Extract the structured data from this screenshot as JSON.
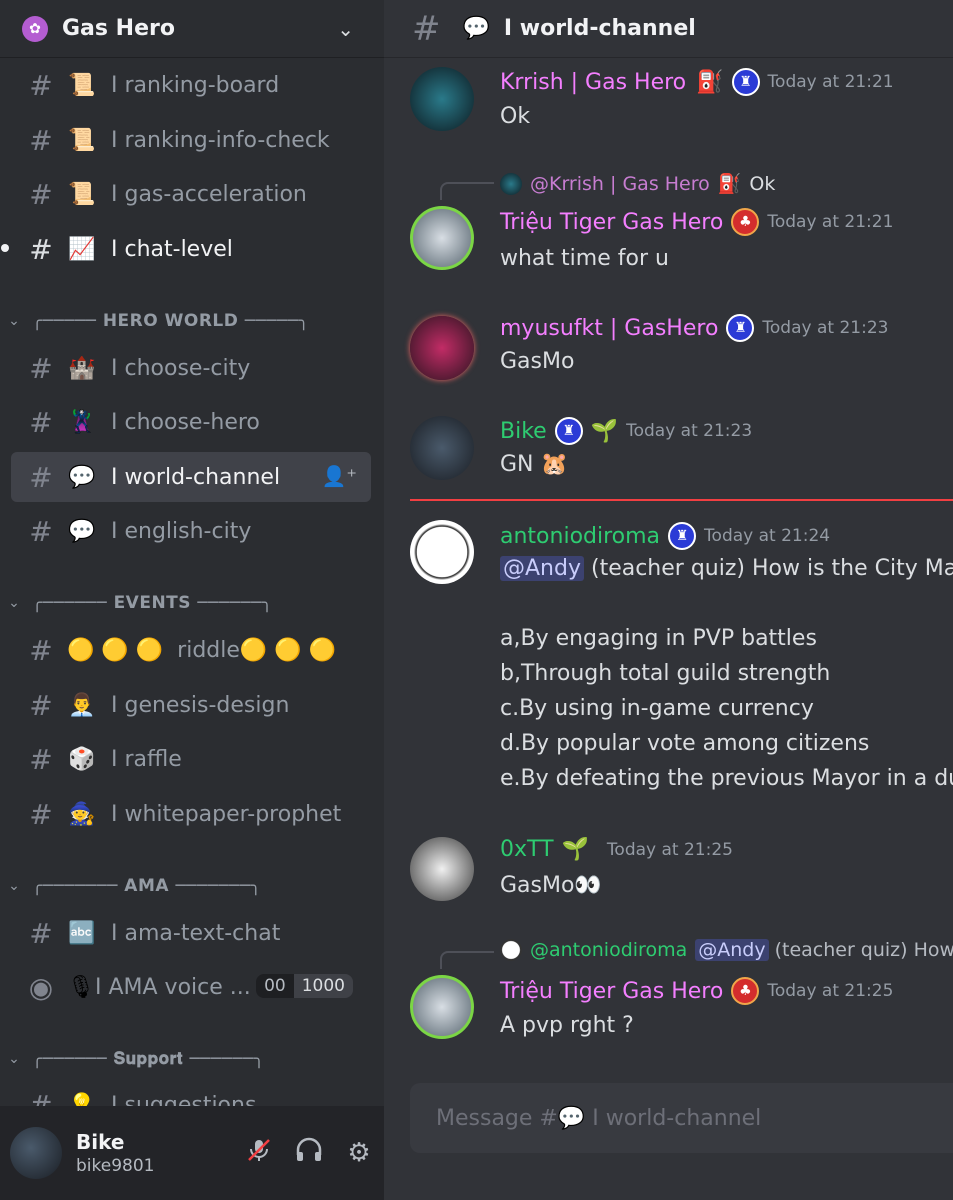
{
  "server": {
    "name": "Gas Hero",
    "icon": "gas-hero-server-icon"
  },
  "channels_top": [
    {
      "emoji": "📜",
      "name": "I ranking-board"
    },
    {
      "emoji": "📜",
      "name": "I ranking-info-check"
    },
    {
      "emoji": "📜",
      "name": "I gas-acceleration"
    },
    {
      "emoji": "📈",
      "name": "I chat-level"
    }
  ],
  "categories": {
    "hero_world": "╭───── HERO WORLD ─────╮",
    "events": "╭────── EVENTS ──────╮",
    "ama": "╭─────── AMA ───────╮",
    "support": "╭────── 𝐒𝐮𝐩𝐩𝐨𝐫𝐭 ──────╮"
  },
  "channels_hero_world": [
    {
      "emoji": "🏰",
      "name": "I choose-city"
    },
    {
      "emoji": "🦹",
      "name": "I choose-hero"
    },
    {
      "emoji": "💬",
      "name": "I world-channel"
    },
    {
      "emoji": "💬",
      "name": "I english-city"
    }
  ],
  "channels_events": [
    {
      "emoji": "🟡 🟡 🟡",
      "name": "riddle🟡 🟡 🟡"
    },
    {
      "emoji": "👨‍💼",
      "name": "I genesis-design"
    },
    {
      "emoji": "🎲",
      "name": "I raffle"
    },
    {
      "emoji": "🧙",
      "name": "I whitepaper-prophet"
    }
  ],
  "channels_ama": [
    {
      "emoji": "🔤",
      "name": "I ama-text-chat"
    },
    {
      "emoji": "🎙",
      "name": "I AMA voice ..."
    }
  ],
  "voice_badge": {
    "left": "00",
    "right": "1000"
  },
  "channels_support": [
    {
      "emoji": "💡",
      "name": "I suggestions"
    }
  ],
  "user": {
    "name": "Bike",
    "tag": "bike9801"
  },
  "header": {
    "emoji": "💬",
    "channel": "I world-channel"
  },
  "messages": [
    {
      "author": "Krrish | Gas Hero",
      "author_suffix": "⛽",
      "time": "Today at 21:21",
      "text": "Ok"
    },
    {
      "reply_author": "@Krrish | Gas Hero",
      "reply_suffix": "⛽",
      "reply_text": "Ok",
      "author": "Triệu Tiger Gas Hero",
      "time": "Today at 21:21",
      "text": "what time for u"
    },
    {
      "author": "myusufkt | GasHero",
      "time": "Today at 21:23",
      "text": "GasMo"
    },
    {
      "author": "Bike",
      "author_suffix": "🌱",
      "time": "Today at 21:23",
      "text": "GN 🐹"
    },
    {
      "author": "antoniodiroma",
      "time": "Today at 21:24",
      "mention": "@Andy",
      "text": "(teacher quiz) How is the City Mayor elected?",
      "lines": [
        "a,By engaging in PVP battles",
        "b,Through total guild strength",
        "c.By using in-game currency",
        "d.By popular vote among citizens",
        "e.By defeating the previous Mayor in a duel"
      ]
    },
    {
      "author": "0xTT",
      "author_suffix": "🌱",
      "time": "Today at 21:25",
      "text": "GasMo👀"
    },
    {
      "reply_author": "@antoniodiroma",
      "reply_mention": "@Andy",
      "reply_text": "(teacher quiz) How is the City Mayor elected?",
      "author": "Triệu Tiger Gas Hero",
      "time": "Today at 21:25",
      "text": "A pvp rght ?"
    }
  ],
  "input": {
    "placeholder": "Message #💬 I world-channel"
  },
  "colors": {
    "pink": "#f47fff",
    "green": "#2ecc71",
    "accent": "#5865f2"
  }
}
